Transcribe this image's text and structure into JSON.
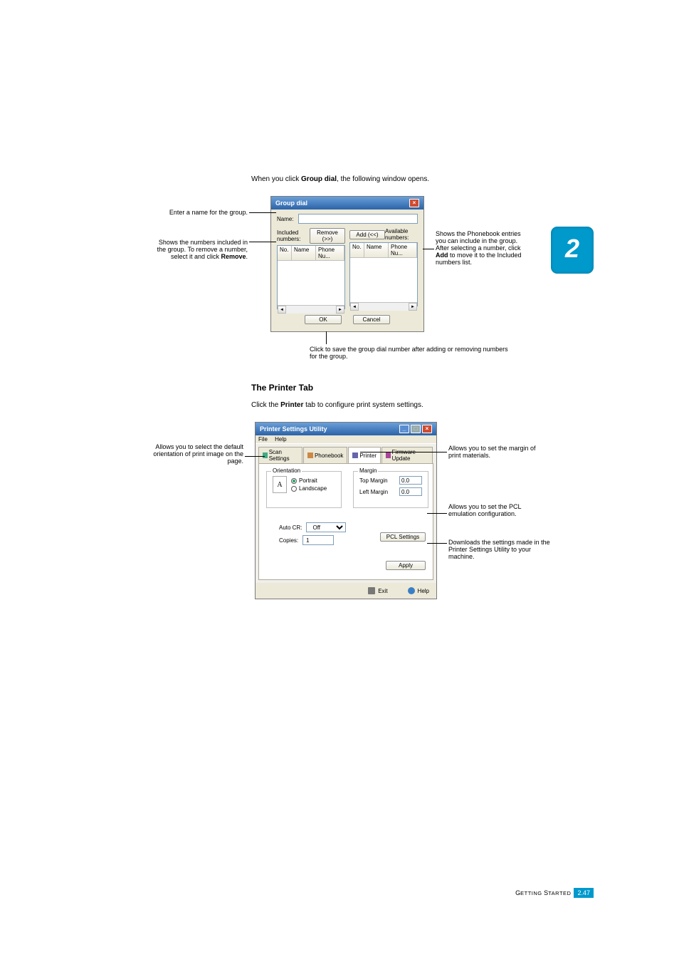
{
  "intro": {
    "pre": "When you click ",
    "b": "Group dial",
    "post": ", the following window opens."
  },
  "chapter": "2",
  "dialog1": {
    "title": "Group dial",
    "name_lbl": "Name:",
    "name_val": "",
    "incl_lbl": "Included numbers:",
    "avail_lbl": "Available numbers:",
    "remove_btn": "Remove (>>)",
    "add_btn": "Add (<<)",
    "cols": {
      "no": "No.",
      "name": "Name",
      "phone": "Phone Nu..."
    },
    "ok": "OK",
    "cancel": "Cancel"
  },
  "callouts1": {
    "left1": "Enter a name for the group.",
    "left2": {
      "a": "Shows the numbers included in the group. To remove a number, select it and click ",
      "b": "Remove",
      "c": "."
    },
    "right1": {
      "a": "Shows the Phonebook entries you can include in the group. After selecting a number, click ",
      "b": "Add",
      "c": " to move it to the Included numbers list."
    },
    "below": "Click to save the group dial number after adding or removing numbers for the group."
  },
  "section2": {
    "heading": "The Printer Tab",
    "desc": {
      "pre": "Click the ",
      "b": "Printer",
      "post": " tab to configure print system settings."
    }
  },
  "dialog2": {
    "title": "Printer Settings Utility",
    "menu": {
      "file": "File",
      "help": "Help"
    },
    "tabs": {
      "scan": "Scan Settings",
      "phone": "Phonebook",
      "printer": "Printer",
      "fw": "Firmware Update"
    },
    "orient": {
      "legend": "Orientation",
      "portrait": "Portrait",
      "landscape": "Landscape"
    },
    "margin": {
      "legend": "Margin",
      "top_lbl": "Top Margin",
      "top_val": "0.0",
      "left_lbl": "Left Margin",
      "left_val": "0.0"
    },
    "autocr": {
      "lbl": "Auto CR:",
      "val": "Off"
    },
    "copies": {
      "lbl": "Copies:",
      "val": "1"
    },
    "pcl_btn": "PCL Settings",
    "apply_btn": "Apply",
    "exit": "Exit",
    "help": "Help"
  },
  "callouts2": {
    "left": "Allows you to select the default orientation of print image on the page.",
    "r_margin": "Allows you to set the margin of print materials.",
    "r_pcl": "Allows you to set the PCL emulation configuration.",
    "r_apply": "Downloads the settings made in the Printer Settings Utility to your machine."
  },
  "footer": {
    "label_a": "G",
    "label_b": "ETTING",
    "label_c": " S",
    "label_d": "TARTED",
    "page": "2.47"
  }
}
